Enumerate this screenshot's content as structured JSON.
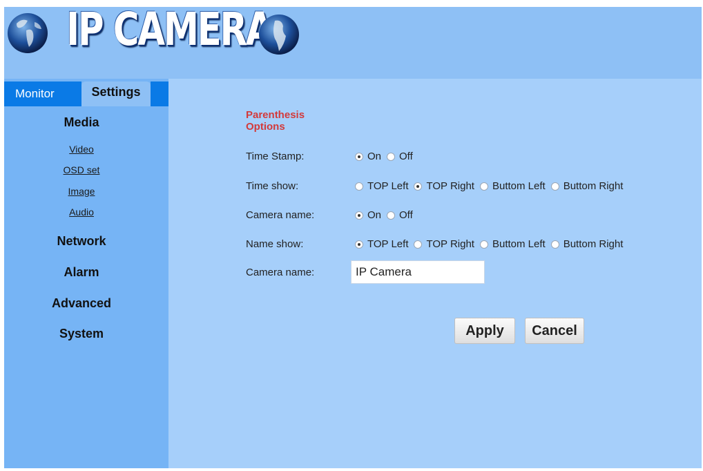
{
  "header": {
    "logo_text": "IP CAMERA"
  },
  "tabs": {
    "monitor": "Monitor",
    "settings": "Settings"
  },
  "sidebar": {
    "media": "Media",
    "media_items": [
      "Video",
      "OSD set",
      "Image",
      "Audio"
    ],
    "network": "Network",
    "alarm": "Alarm",
    "advanced": "Advanced",
    "system": "System"
  },
  "form": {
    "section_title": "Parenthesis Options",
    "time_stamp": {
      "label": "Time Stamp:",
      "options": [
        "On",
        "Off"
      ],
      "selected": "On"
    },
    "time_show": {
      "label": "Time show:",
      "options": [
        "TOP Left",
        "TOP Right",
        "Buttom Left",
        "Buttom Right"
      ],
      "selected": "TOP Right"
    },
    "camera_name_toggle": {
      "label": "Camera name:",
      "options": [
        "On",
        "Off"
      ],
      "selected": "On"
    },
    "name_show": {
      "label": "Name show:",
      "options": [
        "TOP Left",
        "TOP Right",
        "Buttom Left",
        "Buttom Right"
      ],
      "selected": "TOP Left"
    },
    "camera_name_text": {
      "label": "Camera name:",
      "value": "IP Camera"
    },
    "apply": "Apply",
    "cancel": "Cancel"
  },
  "colors": {
    "header_bg": "#8ec0f5",
    "sidebar_bg": "#76b4f5",
    "main_bg": "#a6cffa",
    "tab_active_bg": "#0a7ae6",
    "section_title": "#d33a3a"
  },
  "icons": [
    "globe-left-icon",
    "globe-right-icon"
  ]
}
